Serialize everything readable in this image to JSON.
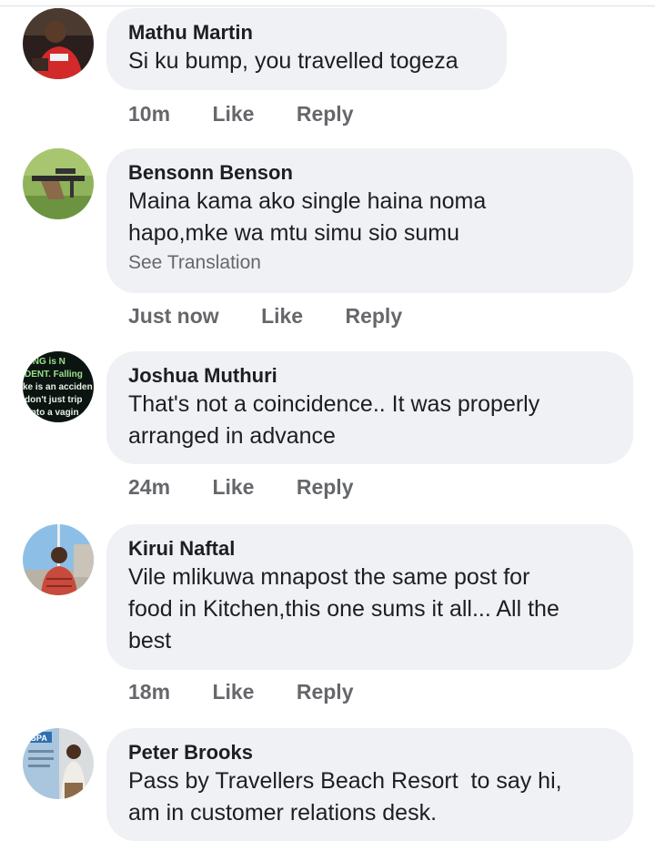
{
  "comments": [
    {
      "author": "Mathu Martin",
      "text": "Si ku bump, you travelled togeza",
      "time": "10m",
      "like_label": "Like",
      "reply_label": "Reply"
    },
    {
      "author": "Bensonn Benson",
      "text": "Maina kama ako single haina noma\nhapo,mke wa mtu simu sio sumu",
      "see_translation": "See Translation",
      "time": "Just now",
      "like_label": "Like",
      "reply_label": "Reply"
    },
    {
      "author": "Joshua Muthuri",
      "text": "That's not a coincidence.. It was properly\narranged in advance",
      "time": "24m",
      "like_label": "Like",
      "reply_label": "Reply",
      "avatar_text": [
        "ING is N",
        "DENT. Falling",
        "ke is an acciden",
        "don't just trip",
        "into a vagin"
      ]
    },
    {
      "author": "Kirui Naftal",
      "text": "Vile mlikuwa mnapost the same post for\nfood in Kitchen,this one sums it all... All the\nbest",
      "time": "18m",
      "like_label": "Like",
      "reply_label": "Reply"
    },
    {
      "author": "Peter Brooks",
      "text": "Pass by Travellers Beach Resort  to say hi,\nam in customer relations desk.",
      "avatar_text": "GPA"
    }
  ],
  "colors": {
    "bubble": "#eff1f4",
    "text": "#1c1e21",
    "secondary": "#65676b"
  }
}
